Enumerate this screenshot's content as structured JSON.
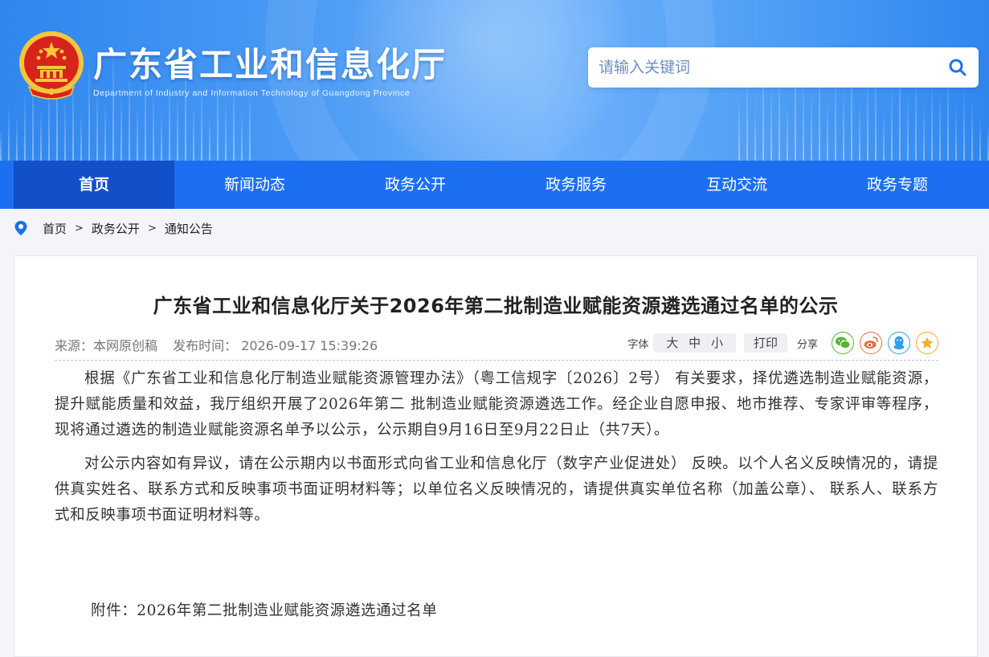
{
  "header": {
    "title": "广东省工业和信息化厅",
    "subtitle": "Department of Industry and Information Technology of Guangdong Province",
    "search_placeholder": "请输入关键词"
  },
  "nav": {
    "items": [
      {
        "label": "首页",
        "active": true
      },
      {
        "label": "新闻动态",
        "active": false
      },
      {
        "label": "政务公开",
        "active": false
      },
      {
        "label": "政务服务",
        "active": false
      },
      {
        "label": "互动交流",
        "active": false
      },
      {
        "label": "政务专题",
        "active": false
      }
    ]
  },
  "breadcrumb": {
    "items": [
      "首页",
      "政务公开",
      "通知公告"
    ],
    "separator": ">"
  },
  "article": {
    "title": "广东省工业和信息化厅关于2026年第二批制造业赋能资源遴选通过名单的公示",
    "source": "来源：本网原创稿",
    "publish_time": "发布时间： 2026-09-17 15:39:26",
    "tools": {
      "font_label": "字体",
      "font_large": "大",
      "font_medium": "中",
      "font_small": "小",
      "print": "打印",
      "share_label": "分享"
    },
    "paragraphs": [
      "根据《广东省工业和信息化厅制造业赋能资源管理办法》（粤工信规字〔2026〕2号） 有关要求，择优遴选制造业赋能资源，提升赋能质量和效益，我厅组织开展了2026年第二 批制造业赋能资源遴选工作。经企业自愿申报、地市推荐、专家评审等程序，现将通过遴选的制造业赋能资源名单予以公示，公示期自9月16日至9月22日止（共7天）。",
      "对公示内容如有异议，请在公示期内以书面形式向省工业和信息化厅（数字产业促进处） 反映。以个人名义反映情况的，请提供真实姓名、联系方式和反映事项书面证明材料等；以单位名义反映情况的，请提供真实单位名称（加盖公章）、 联系人、联系方式和反映事项书面证明材料等。"
    ],
    "attachment": "附件：2026年第二批制造业赋能资源遴选通过名单"
  },
  "icons": {
    "emblem": "national-emblem-icon",
    "search": "search-icon",
    "location": "location-pin-icon",
    "share": [
      "wechat-icon",
      "weibo-icon",
      "qq-icon",
      "favorite-icon"
    ]
  },
  "colors": {
    "nav_bg": "#1d6ff2",
    "nav_active": "#1150c8",
    "banner": "#4a9af5",
    "emblem_red": "#d8231c",
    "emblem_gold": "#f6c63c"
  }
}
